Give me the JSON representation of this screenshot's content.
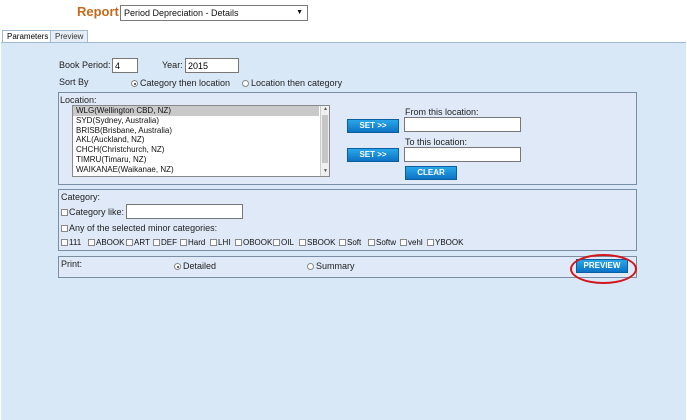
{
  "header": {
    "report_label": "Report:",
    "report_selected": "Period Depreciation - Details"
  },
  "tabs": [
    {
      "label": "Parameters"
    },
    {
      "label": "Preview"
    }
  ],
  "period": {
    "book_period_label": "Book Period:",
    "book_period_value": "4",
    "year_label": "Year:",
    "year_value": "2015"
  },
  "sort": {
    "label": "Sort By",
    "options": [
      "Category then location",
      "Location then category"
    ],
    "selected_index": 0
  },
  "location": {
    "label": "Location:",
    "items": [
      "WLG(Wellington CBD, NZ)",
      "SYD(Sydney, Australia)",
      "BRISB(Brisbane, Australia)",
      "AKL(Auckland, NZ)",
      "CHCH(Christchurch, NZ)",
      "TIMRU(Timaru, NZ)",
      "WAIKANAE(Waikanae, NZ)"
    ],
    "selected_index": 0,
    "set_label": "SET >>",
    "from_label": "From this location:",
    "to_label": "To this location:",
    "clear_label": "CLEAR"
  },
  "category": {
    "label": "Category:",
    "like_label": "Category like:",
    "any_label": "Any of the selected minor categories:",
    "minors": [
      "111",
      "ABOOK",
      "ART",
      "DEF",
      "Hard",
      "LHI",
      "OBOOK",
      "OIL",
      "SBOOK",
      "Soft",
      "Softw",
      "vehl",
      "YBOOK"
    ]
  },
  "print": {
    "label": "Print:",
    "options": [
      "Detailed",
      "Summary"
    ],
    "selected_index": 0,
    "preview_label": "PREVIEW"
  },
  "colors": {
    "highlight_ring": "#d2161c",
    "panel_bg": "#d9e8f7",
    "button_blue": "#1a8fd8",
    "report_label": "#c46a1b"
  }
}
